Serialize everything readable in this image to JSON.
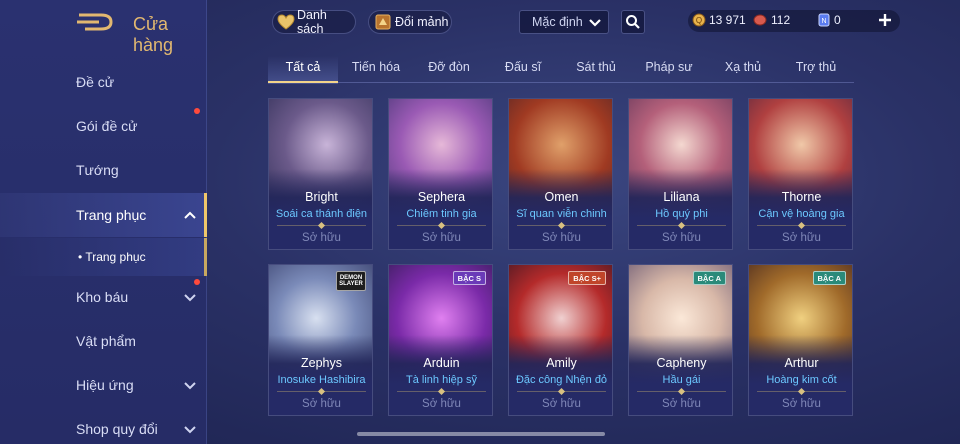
{
  "header": {
    "title": "Cửa hàng"
  },
  "sidebar": {
    "items": [
      {
        "label": "Đề cử"
      },
      {
        "label": "Gói đề cử"
      },
      {
        "label": "Tướng"
      },
      {
        "label": "Trang phục"
      },
      {
        "label": "Kho báu"
      },
      {
        "label": "Vật phẩm"
      },
      {
        "label": "Hiệu ứng"
      },
      {
        "label": "Shop quy đổi"
      }
    ],
    "sub_item": {
      "label": "• Trang phục"
    }
  },
  "toolbar": {
    "list_label": "Danh sách",
    "exchange_label": "Đổi mảnh",
    "sort_value": "Mặc định"
  },
  "currencies": [
    {
      "name": "vouchers",
      "value": "13 971",
      "color": "#e9b44c"
    },
    {
      "name": "gems",
      "value": "112",
      "color": "#d85a4e"
    },
    {
      "name": "tickets",
      "value": "0",
      "color": "#5b7cf0"
    }
  ],
  "tabs": [
    {
      "label": "Tất cả"
    },
    {
      "label": "Tiến hóa"
    },
    {
      "label": "Đỡ đòn"
    },
    {
      "label": "Đấu sĩ"
    },
    {
      "label": "Sát thủ"
    },
    {
      "label": "Pháp sư"
    },
    {
      "label": "Xạ thủ"
    },
    {
      "label": "Trợ thủ"
    }
  ],
  "cards": [
    {
      "hero": "Bright",
      "skin": "Soái ca thánh điện",
      "status": "Sở hữu",
      "badge": ""
    },
    {
      "hero": "Sephera",
      "skin": "Chiêm tinh gia",
      "status": "Sở hữu",
      "badge": ""
    },
    {
      "hero": "Omen",
      "skin": "Sĩ quan viễn chinh",
      "status": "Sở hữu",
      "badge": ""
    },
    {
      "hero": "Liliana",
      "skin": "Hồ quý phi",
      "status": "Sở hữu",
      "badge": ""
    },
    {
      "hero": "Thorne",
      "skin": "Cận vệ hoàng gia",
      "status": "Sở hữu",
      "badge": ""
    },
    {
      "hero": "Zephys",
      "skin": "Inosuke Hashibira",
      "status": "Sở hữu",
      "badge": "DEMON SLAYER"
    },
    {
      "hero": "Arduin",
      "skin": "Tà linh hiệp sỹ",
      "status": "Sở hữu",
      "badge": "BẬC S"
    },
    {
      "hero": "Amily",
      "skin": "Đặc công Nhện đỏ",
      "status": "Sở hữu",
      "badge": "BẬC S+"
    },
    {
      "hero": "Capheny",
      "skin": "Hầu gái",
      "status": "Sở hữu",
      "badge": "BẬC A"
    },
    {
      "hero": "Arthur",
      "skin": "Hoàng kim cốt",
      "status": "Sở hữu",
      "badge": "BẬC A"
    }
  ],
  "colors": {
    "accent": "#f0c76a",
    "skin_text": "#6cc8ff",
    "sidebar_bg": "#2a3170"
  }
}
